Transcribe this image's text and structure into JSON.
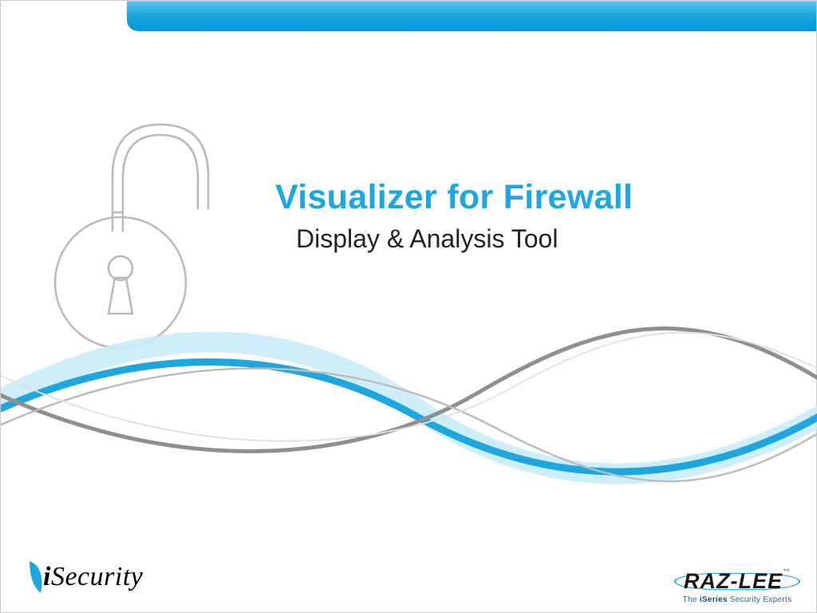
{
  "slide": {
    "title": "Visualizer for Firewall",
    "subtitle": "Display & Analysis Tool"
  },
  "branding": {
    "left_logo": {
      "prefix": "i",
      "word": "Security"
    },
    "right_logo": {
      "name": "RAZ-LEE",
      "trademark": "™",
      "tagline_prefix": "The ",
      "tagline_bold": "iSeries",
      "tagline_suffix": " Security Experts"
    }
  },
  "colors": {
    "accent": "#1ea7df",
    "wave_gray": "#8d8f91",
    "wave_light": "#c9ecf8",
    "text": "#222222"
  }
}
